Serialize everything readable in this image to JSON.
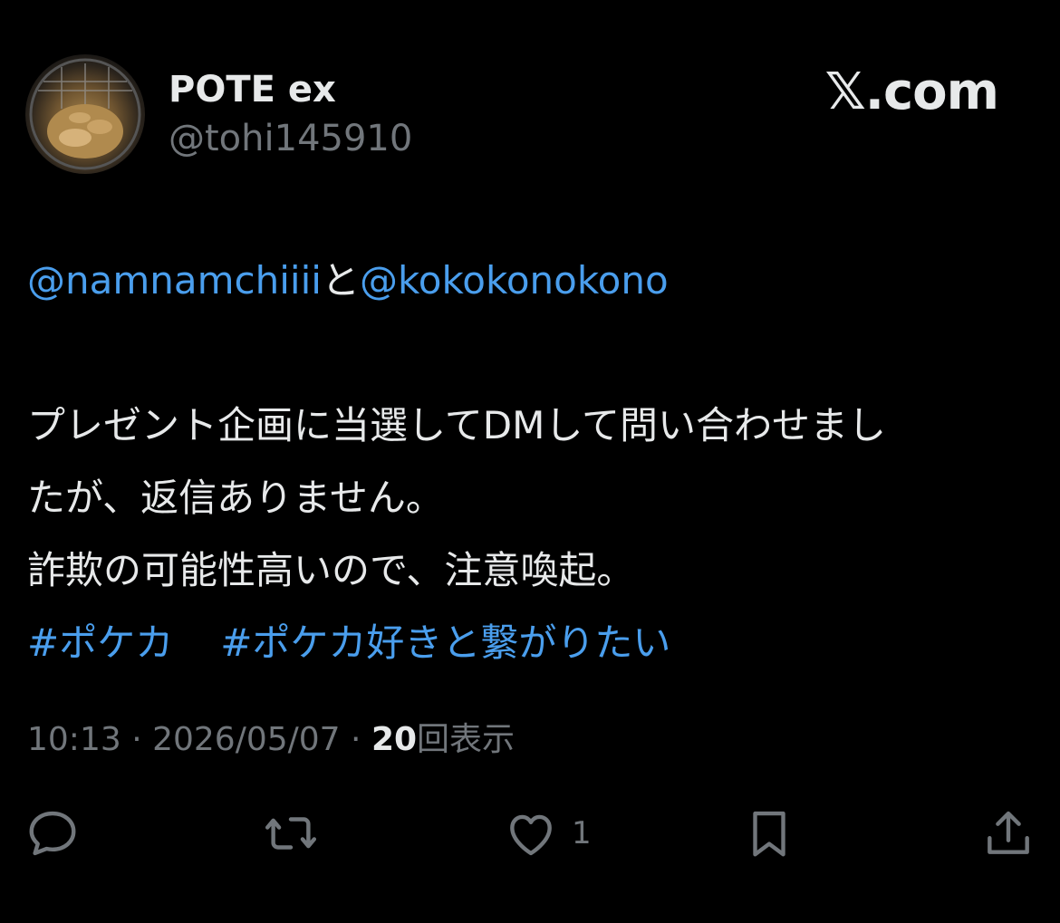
{
  "author": {
    "display_name": "POTE ex",
    "handle": "@tohi145910",
    "avatar_icon": "avatar-photo-fryer"
  },
  "brand": {
    "label": "𝕏.com"
  },
  "tweet": {
    "mention_1": "@namnamchiiii",
    "connector": "と",
    "mention_2": "@kokokonokono",
    "line_1": "プレゼント企画に当選してDMして問い合わせまし",
    "line_2": "たが、返信ありません。",
    "line_3": "詐欺の可能性高いので、注意喚起。",
    "hashtag_1": "#ポケカ",
    "hashtag_2": "#ポケカ好きと繋がりたい"
  },
  "meta": {
    "time": "10:13",
    "separator": " · ",
    "date": "2026/05/07",
    "views_count": "20",
    "views_label": "回表示"
  },
  "actions": {
    "reply_icon": "reply-icon",
    "retweet_icon": "retweet-icon",
    "like_icon": "heart-icon",
    "like_count": "1",
    "bookmark_icon": "bookmark-icon",
    "share_icon": "share-icon"
  },
  "colors": {
    "background": "#000000",
    "text": "#e7e9ea",
    "muted": "#71767b",
    "link": "#4a9eed"
  }
}
